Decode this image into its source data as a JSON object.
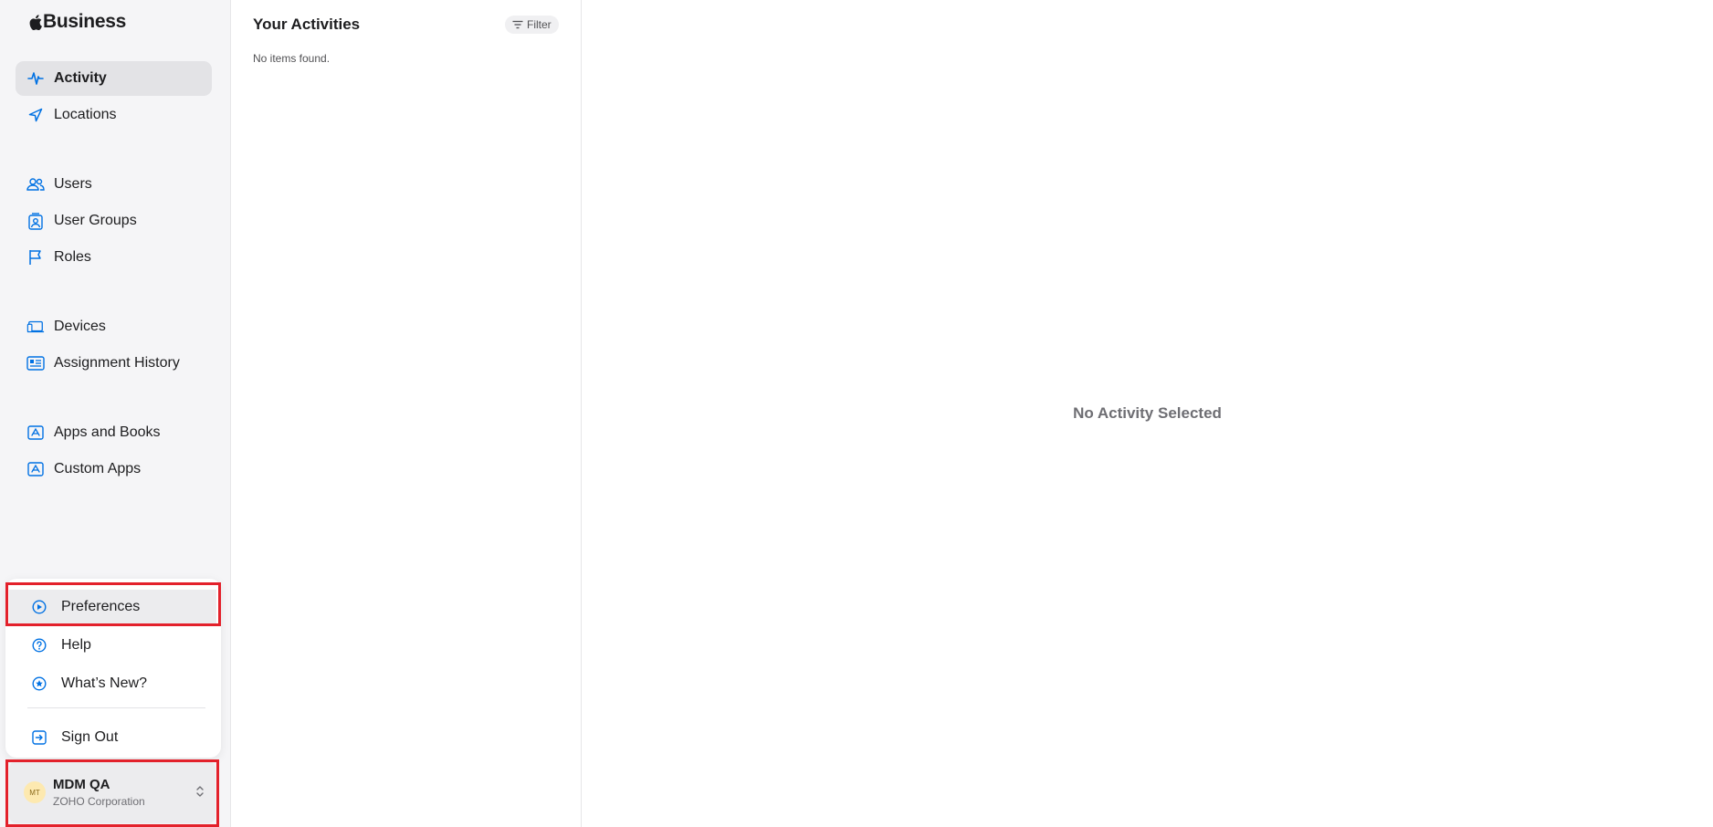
{
  "brand": {
    "name": "Business"
  },
  "sidebar": {
    "items": [
      {
        "label": "Activity",
        "icon": "activity-icon",
        "active": true
      },
      {
        "label": "Locations",
        "icon": "location-arrow-icon"
      },
      {
        "label": "Users",
        "icon": "users-icon"
      },
      {
        "label": "User Groups",
        "icon": "user-groups-icon"
      },
      {
        "label": "Roles",
        "icon": "flag-icon"
      },
      {
        "label": "Devices",
        "icon": "devices-icon"
      },
      {
        "label": "Assignment History",
        "icon": "assignment-history-icon"
      },
      {
        "label": "Apps and Books",
        "icon": "apps-icon"
      },
      {
        "label": "Custom Apps",
        "icon": "custom-apps-icon"
      }
    ]
  },
  "account_menu": {
    "items": [
      {
        "label": "Preferences",
        "icon": "preferences-icon"
      },
      {
        "label": "Help",
        "icon": "help-icon"
      },
      {
        "label": "What’s New?",
        "icon": "whats-new-icon"
      },
      {
        "label": "Sign Out",
        "icon": "sign-out-icon"
      }
    ]
  },
  "account": {
    "initials": "MT",
    "name": "MDM QA",
    "org": "ZOHO Corporation"
  },
  "list": {
    "title": "Your Activities",
    "filter_label": "Filter",
    "empty_text": "No items found."
  },
  "detail": {
    "empty_text": "No Activity Selected"
  },
  "colors": {
    "accent": "#0071e3",
    "highlight": "#e3212b",
    "sidebar_bg": "#f5f5f7"
  }
}
